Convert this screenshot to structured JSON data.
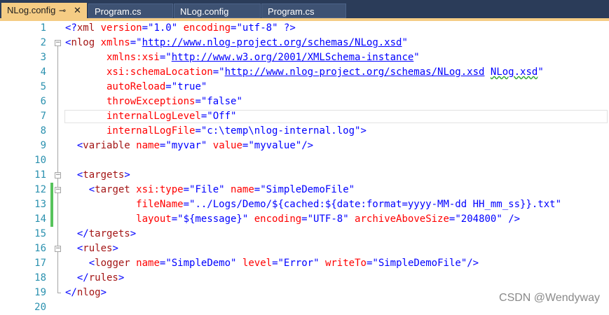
{
  "tabs": [
    {
      "label": "NLog.config",
      "pin_icon": "pin-icon",
      "close_icon": "close-icon",
      "active": true
    },
    {
      "label": "Program.cs",
      "active": false
    },
    {
      "label": "NLog.config",
      "active": false
    },
    {
      "label": "Program.cs",
      "active": false
    }
  ],
  "editor": {
    "lines": [
      {
        "num": "1",
        "segs": [
          [
            "v",
            "<?"
          ],
          [
            "t",
            "xml"
          ],
          [
            "a",
            " version"
          ],
          [
            "v",
            "=\""
          ],
          [
            "v",
            "1.0"
          ],
          [
            "v",
            "\""
          ],
          [
            "a",
            " encoding"
          ],
          [
            "v",
            "=\""
          ],
          [
            "v",
            "utf-8"
          ],
          [
            "v",
            "\""
          ],
          [
            "v",
            " ?>"
          ]
        ]
      },
      {
        "num": "2",
        "segs": [
          [
            "v",
            "<"
          ],
          [
            "t",
            "nlog"
          ],
          [
            "a",
            " xmlns"
          ],
          [
            "v",
            "=\""
          ],
          [
            "u",
            "http://www.nlog-project.org/schemas/NLog.xsd"
          ],
          [
            "v",
            "\""
          ]
        ]
      },
      {
        "num": "3",
        "segs": [
          [
            "a",
            "       xmlns:xsi"
          ],
          [
            "v",
            "=\""
          ],
          [
            "u",
            "http://www.w3.org/2001/XMLSchema-instance"
          ],
          [
            "v",
            "\""
          ]
        ]
      },
      {
        "num": "4",
        "segs": [
          [
            "a",
            "       xsi:schemaLocation"
          ],
          [
            "v",
            "=\""
          ],
          [
            "u",
            "http://www.nlog-project.org/schemas/NLog.xsd"
          ],
          [
            "v",
            " "
          ],
          [
            "uq",
            "NLog.xsd"
          ],
          [
            "v",
            "\""
          ]
        ]
      },
      {
        "num": "5",
        "segs": [
          [
            "a",
            "       autoReload"
          ],
          [
            "v",
            "=\""
          ],
          [
            "v",
            "true"
          ],
          [
            "v",
            "\""
          ]
        ]
      },
      {
        "num": "6",
        "segs": [
          [
            "a",
            "       throwExceptions"
          ],
          [
            "v",
            "=\""
          ],
          [
            "v",
            "false"
          ],
          [
            "v",
            "\""
          ]
        ]
      },
      {
        "num": "7",
        "segs": [
          [
            "a",
            "       internalLogLevel"
          ],
          [
            "v",
            "=\""
          ],
          [
            "v",
            "Off"
          ],
          [
            "v",
            "\""
          ]
        ]
      },
      {
        "num": "8",
        "segs": [
          [
            "a",
            "       internalLogFile"
          ],
          [
            "v",
            "=\""
          ],
          [
            "v",
            "c:\\temp\\nlog-internal.log"
          ],
          [
            "v",
            "\">"
          ]
        ]
      },
      {
        "num": "9",
        "segs": [
          [
            "v",
            "  <"
          ],
          [
            "t",
            "variable"
          ],
          [
            "a",
            " name"
          ],
          [
            "v",
            "=\""
          ],
          [
            "v",
            "myvar"
          ],
          [
            "v",
            "\""
          ],
          [
            "a",
            " value"
          ],
          [
            "v",
            "=\""
          ],
          [
            "v",
            "myvalue"
          ],
          [
            "v",
            "\"/>"
          ]
        ]
      },
      {
        "num": "10",
        "segs": []
      },
      {
        "num": "11",
        "segs": [
          [
            "v",
            "  <"
          ],
          [
            "t",
            "targets"
          ],
          [
            "v",
            ">"
          ]
        ]
      },
      {
        "num": "12",
        "segs": [
          [
            "v",
            "    <"
          ],
          [
            "t",
            "target"
          ],
          [
            "a",
            " xsi:type"
          ],
          [
            "v",
            "=\""
          ],
          [
            "v",
            "File"
          ],
          [
            "v",
            "\""
          ],
          [
            "a",
            " name"
          ],
          [
            "v",
            "=\""
          ],
          [
            "v",
            "SimpleDemoFile"
          ],
          [
            "v",
            "\""
          ]
        ]
      },
      {
        "num": "13",
        "segs": [
          [
            "a",
            "            fileName"
          ],
          [
            "v",
            "=\""
          ],
          [
            "v",
            "../Logs/Demo/${cached:${date:format=yyyy-MM-dd HH_mm_ss}}.txt"
          ],
          [
            "v",
            "\""
          ]
        ]
      },
      {
        "num": "14",
        "segs": [
          [
            "a",
            "            layout"
          ],
          [
            "v",
            "=\""
          ],
          [
            "v",
            "${message}"
          ],
          [
            "v",
            "\""
          ],
          [
            "a",
            " encoding"
          ],
          [
            "v",
            "=\""
          ],
          [
            "v",
            "UTF-8"
          ],
          [
            "v",
            "\""
          ],
          [
            "a",
            " archiveAboveSize"
          ],
          [
            "v",
            "=\""
          ],
          [
            "v",
            "204800"
          ],
          [
            "v",
            "\" />"
          ]
        ]
      },
      {
        "num": "15",
        "segs": [
          [
            "v",
            "  </"
          ],
          [
            "t",
            "targets"
          ],
          [
            "v",
            ">"
          ]
        ]
      },
      {
        "num": "16",
        "segs": [
          [
            "v",
            "  <"
          ],
          [
            "t",
            "rules"
          ],
          [
            "v",
            ">"
          ]
        ]
      },
      {
        "num": "17",
        "segs": [
          [
            "v",
            "    <"
          ],
          [
            "t",
            "logger"
          ],
          [
            "a",
            " name"
          ],
          [
            "v",
            "=\""
          ],
          [
            "v",
            "SimpleDemo"
          ],
          [
            "v",
            "\""
          ],
          [
            "a",
            " level"
          ],
          [
            "v",
            "=\""
          ],
          [
            "v",
            "Error"
          ],
          [
            "v",
            "\""
          ],
          [
            "a",
            " writeTo"
          ],
          [
            "v",
            "=\""
          ],
          [
            "v",
            "SimpleDemoFile"
          ],
          [
            "v",
            "\"/>"
          ]
        ]
      },
      {
        "num": "18",
        "segs": [
          [
            "v",
            "  </"
          ],
          [
            "t",
            "rules"
          ],
          [
            "v",
            ">"
          ]
        ]
      },
      {
        "num": "19",
        "segs": [
          [
            "v",
            "</"
          ],
          [
            "t",
            "nlog"
          ],
          [
            "v",
            ">"
          ]
        ]
      },
      {
        "num": "20",
        "segs": []
      }
    ]
  },
  "watermark": "CSDN @Wendyway"
}
